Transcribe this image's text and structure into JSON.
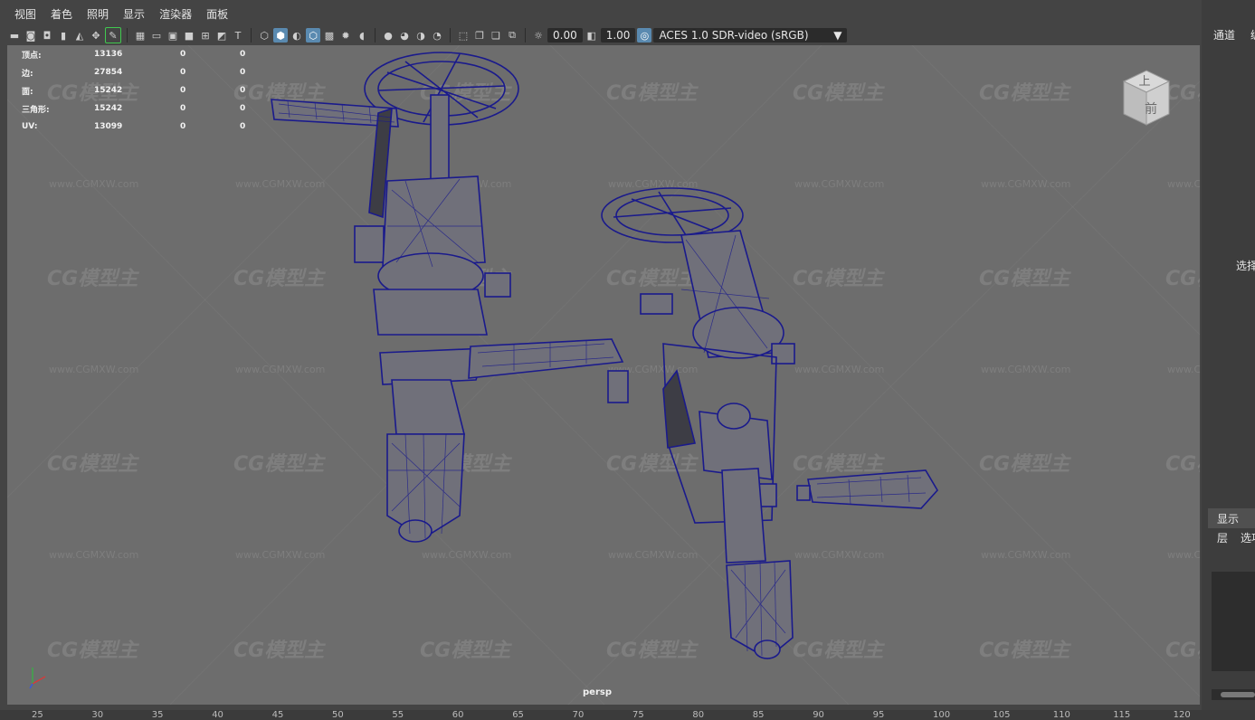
{
  "menu": [
    "视图",
    "着色",
    "照明",
    "显示",
    "渲染器",
    "面板"
  ],
  "toolbar": {
    "exposure": "0.00",
    "gamma": "1.00",
    "color_space": "ACES 1.0 SDR-video (sRGB)",
    "icons": [
      "camera-icon",
      "camera-attr-icon",
      "bookmark-icon",
      "image-plane-icon",
      "grease-pencil-icon",
      "grid-icon",
      "film-gate-icon",
      "resolution-gate-icon",
      "gate-mask-icon",
      "field-chart-icon",
      "safe-action-icon",
      "safe-title-icon",
      "wireframe-icon",
      "smooth-shade-icon",
      "wireframe-on-shaded-icon",
      "xray-icon",
      "textured-icon",
      "lighting-icon",
      "shadows-icon",
      "ambient-occlusion-icon",
      "motion-blur-icon",
      "antialias-icon",
      "depth-of-field-icon",
      "isolate-icon",
      "xray-joint-icon",
      "xray-active-icon",
      "bounding-box-icon",
      "exposure-icon",
      "gamma-icon",
      "color-management-icon",
      "dropdown-icon"
    ]
  },
  "hud": {
    "rows": [
      {
        "label": "顶点:",
        "value": "13136",
        "sel": "0",
        "comp": "0"
      },
      {
        "label": "边:",
        "value": "27854",
        "sel": "0",
        "comp": "0"
      },
      {
        "label": "面:",
        "value": "15242",
        "sel": "0",
        "comp": "0"
      },
      {
        "label": "三角形:",
        "value": "15242",
        "sel": "0",
        "comp": "0"
      },
      {
        "label": "UV:",
        "value": "13099",
        "sel": "0",
        "comp": "0"
      }
    ]
  },
  "camera_name": "persp",
  "view_cube": {
    "top": "上",
    "front": "前"
  },
  "watermark": {
    "logo": "CG模型主",
    "url": "www.CGMXW.com"
  },
  "right_panel": {
    "channels_label": "通道",
    "select_label": "选择",
    "display_tab": "显示",
    "layer_label": "层",
    "options_label": "选项"
  },
  "timeline": {
    "ticks": [
      "25",
      "30",
      "35",
      "40",
      "45",
      "50",
      "55",
      "60",
      "65",
      "70",
      "75",
      "80",
      "85",
      "90",
      "95",
      "100",
      "105",
      "110",
      "115",
      "120"
    ]
  },
  "colors": {
    "viewport_bg": "#6d6d6d",
    "wireframe": "#1a1a8c",
    "mesh_fill": "#6f6f78",
    "accent_active": "#5a8ab0"
  }
}
